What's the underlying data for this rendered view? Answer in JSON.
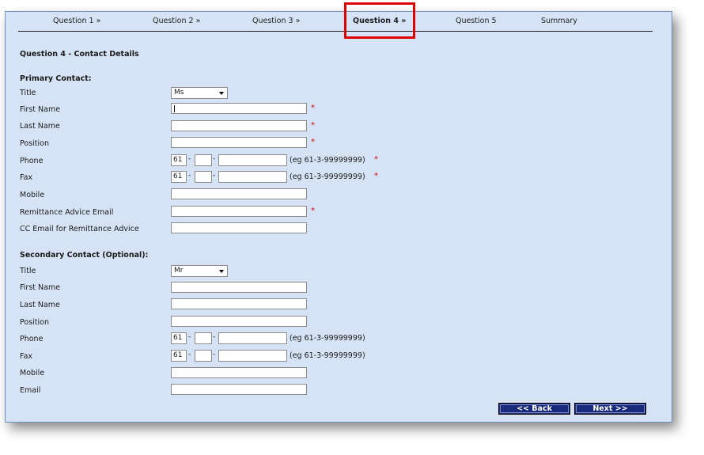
{
  "steps": [
    {
      "label": "Question 1 »"
    },
    {
      "label": "Question 2 »"
    },
    {
      "label": "Question 3 »"
    },
    {
      "label": "Question 4 »"
    },
    {
      "label": "Question 5"
    },
    {
      "label": "Summary"
    }
  ],
  "page_title": "Question 4 - Contact Details",
  "primary": {
    "heading": "Primary Contact:",
    "labels": {
      "title": "Title",
      "first_name": "First Name",
      "last_name": "Last Name",
      "position": "Position",
      "phone": "Phone",
      "fax": "Fax",
      "mobile": "Mobile",
      "remit_email": "Remittance Advice Email",
      "cc_email": "CC Email for Remittance Advice"
    },
    "title_value": "Ms",
    "phone_cc": "61",
    "fax_cc": "61"
  },
  "secondary": {
    "heading": "Secondary Contact (Optional):",
    "labels": {
      "title": "Title",
      "first_name": "First Name",
      "last_name": "Last Name",
      "position": "Position",
      "phone": "Phone",
      "fax": "Fax",
      "mobile": "Mobile",
      "email": "Email"
    },
    "title_value": "Mr",
    "phone_cc": "61",
    "fax_cc": "61"
  },
  "phone_hint": "(eg 61-3-99999999)",
  "required_mark": "*",
  "dash": "-",
  "buttons": {
    "back": "<< Back",
    "next": "Next >>"
  },
  "colors": {
    "panel_bg": "#d6e3f6",
    "button_bg": "#1a2a7a",
    "required": "#d00000",
    "highlight": "#e00000"
  }
}
